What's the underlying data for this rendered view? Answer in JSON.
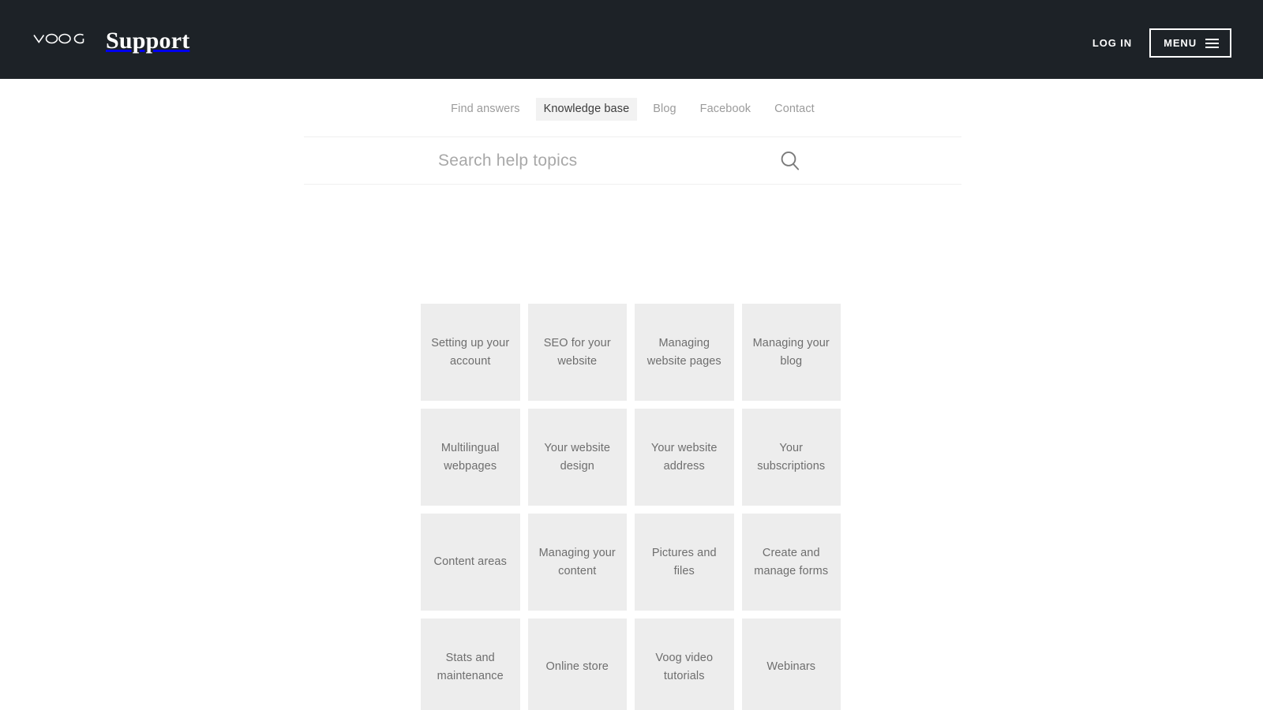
{
  "header": {
    "logo_text": "VOOG",
    "logo_icon": "voog-wordmark-logo",
    "title": "Support",
    "login_label": "LOG IN",
    "menu_label": "MENU",
    "menu_icon": "hamburger-icon",
    "background_color": "#1d2227",
    "text_color": "#ffffff"
  },
  "nav": {
    "tabs": [
      {
        "label": "Find answers",
        "active": false
      },
      {
        "label": "Knowledge base",
        "active": true
      },
      {
        "label": "Blog",
        "active": false
      },
      {
        "label": "Facebook",
        "active": false
      },
      {
        "label": "Contact",
        "active": false
      }
    ],
    "active_tab_background": "#f2f2f2",
    "inactive_tab_color": "#9b9b9b"
  },
  "search": {
    "value": "",
    "placeholder": "Search help topics",
    "icon": "search-icon"
  },
  "topics": {
    "tile_background": "#ededed",
    "tile_text_color": "#6e6e6e",
    "items": [
      {
        "label": "Setting up your account"
      },
      {
        "label": "SEO for your website"
      },
      {
        "label": "Managing website pages"
      },
      {
        "label": "Managing your blog"
      },
      {
        "label": "Multilingual webpages"
      },
      {
        "label": "Your website design"
      },
      {
        "label": "Your website address"
      },
      {
        "label": "Your subscriptions"
      },
      {
        "label": "Content areas"
      },
      {
        "label": "Managing your content"
      },
      {
        "label": "Pictures and files"
      },
      {
        "label": "Create and manage forms"
      },
      {
        "label": "Stats and maintenance"
      },
      {
        "label": "Online store"
      },
      {
        "label": "Voog video tutorials"
      },
      {
        "label": "Webinars"
      }
    ]
  }
}
